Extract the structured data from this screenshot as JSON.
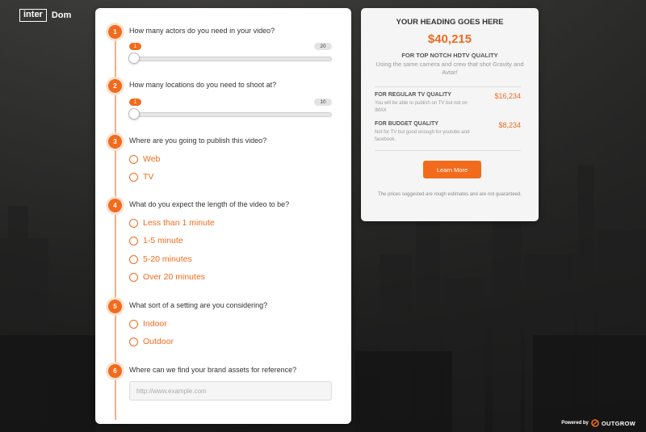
{
  "brand": {
    "part1": "inter",
    "part2": "Dom"
  },
  "form": {
    "questions": [
      {
        "num": "1",
        "title": "How many actors do you need in your video?",
        "min": "1",
        "max": "20",
        "value": 1
      },
      {
        "num": "2",
        "title": "How many locations do you need to shoot at?",
        "min": "1",
        "max": "10",
        "value": 1
      },
      {
        "num": "3",
        "title": "Where are you going to publish this video?",
        "options": [
          "Web",
          "TV"
        ]
      },
      {
        "num": "4",
        "title": "What do you expect the length of the video to be?",
        "options": [
          "Less than 1 minute",
          "1-5 minute",
          "5-20 minutes",
          "Over 20 minutes"
        ]
      },
      {
        "num": "5",
        "title": "What sort of a setting are you considering?",
        "options": [
          "Indoor",
          "Outdoor"
        ]
      },
      {
        "num": "6",
        "title": "Where can we find your brand assets for reference?",
        "placeholder": "http://www.example.com"
      }
    ]
  },
  "result": {
    "heading": "YOUR HEADING GOES HERE",
    "price": "$40,215",
    "subheading": "FOR TOP NOTCH HDTV QUALITY",
    "description": "Using the same camera and crew that shot Gravity and Avtar!",
    "tiers": [
      {
        "name": "FOR REGULAR TV QUALITY",
        "price": "$16,234",
        "desc": "You will be able to publish on TV but not on IMAX"
      },
      {
        "name": "FOR BUDGET QUALITY",
        "price": "$8,234",
        "desc": "Not for TV but good enough for youtube and facebook."
      }
    ],
    "button_label": "Learn More",
    "note": "The prices suggested are rough estimates and are not guaranteed."
  },
  "footer": {
    "powered_by": "Powered by",
    "brand": "OUTGROW"
  },
  "colors": {
    "accent": "#f26b1d"
  }
}
